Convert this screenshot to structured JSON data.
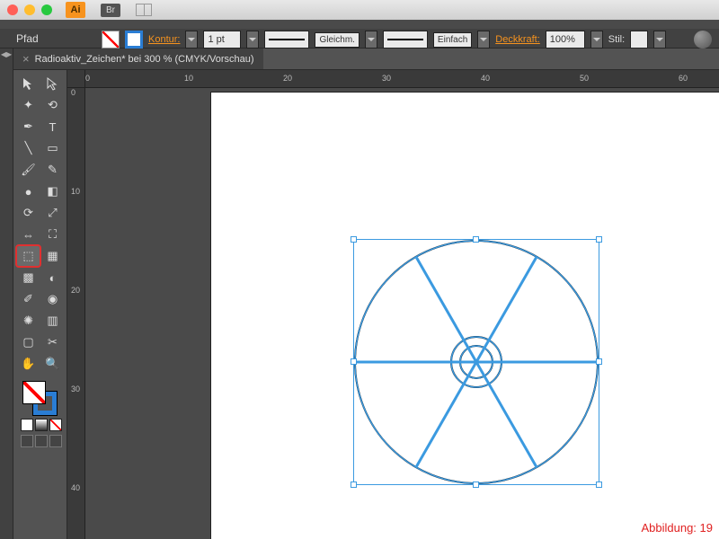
{
  "titlebar": {
    "app": "Ai",
    "bridge": "Br"
  },
  "pfad_label": "Pfad",
  "controlbar": {
    "kontur_label": "Kontur:",
    "stroke_weight": "1 pt",
    "cap_label": "Gleichm.",
    "profile_label": "Einfach",
    "opacity_label": "Deckkraft:",
    "opacity_value": "100%",
    "stil_label": "Stil:"
  },
  "document": {
    "tab_title": "Radioaktiv_Zeichen* bei 300 % (CMYK/Vorschau)"
  },
  "ruler": {
    "h": [
      "0",
      "10",
      "20",
      "30",
      "40",
      "50",
      "60"
    ],
    "v": [
      "0",
      "10",
      "20",
      "30",
      "40"
    ]
  },
  "caption": "Abbildung: 19",
  "colors": {
    "select": "#3b9ae0"
  }
}
